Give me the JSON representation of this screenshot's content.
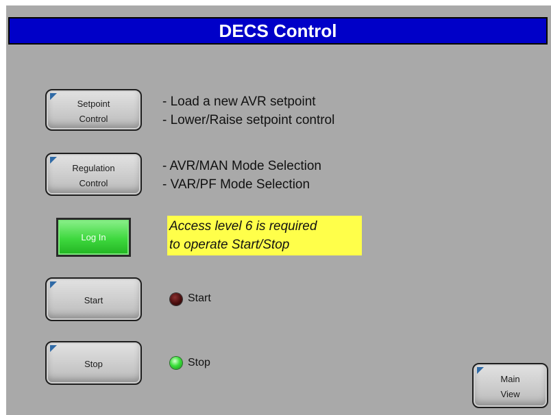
{
  "title": "DECS Control",
  "buttons": {
    "setpoint": "Setpoint\nControl",
    "regulation": "Regulation\nControl",
    "login": "Log In",
    "start": "Start",
    "stop": "Stop",
    "main_view": "Main\nView"
  },
  "descriptions": {
    "setpoint_line1": "- Load a new AVR setpoint",
    "setpoint_line2": "- Lower/Raise setpoint control",
    "regulation_line1": "- AVR/MAN Mode Selection",
    "regulation_line2": "- VAR/PF Mode Selection"
  },
  "access_note": {
    "line1": "Access level 6 is required",
    "line2": "to operate Start/Stop"
  },
  "indicators": {
    "start": {
      "label": "Start",
      "state": "off",
      "color": "#5a1414"
    },
    "stop": {
      "label": "Stop",
      "state": "on",
      "color": "#3ae03a"
    }
  },
  "colors": {
    "title_bar": "#0000c8",
    "background": "#a9a9a9",
    "note_highlight": "#ffff4a",
    "login_button": "#3ed83e"
  },
  "icons": {
    "button_corner": "corner-triangle-icon"
  }
}
